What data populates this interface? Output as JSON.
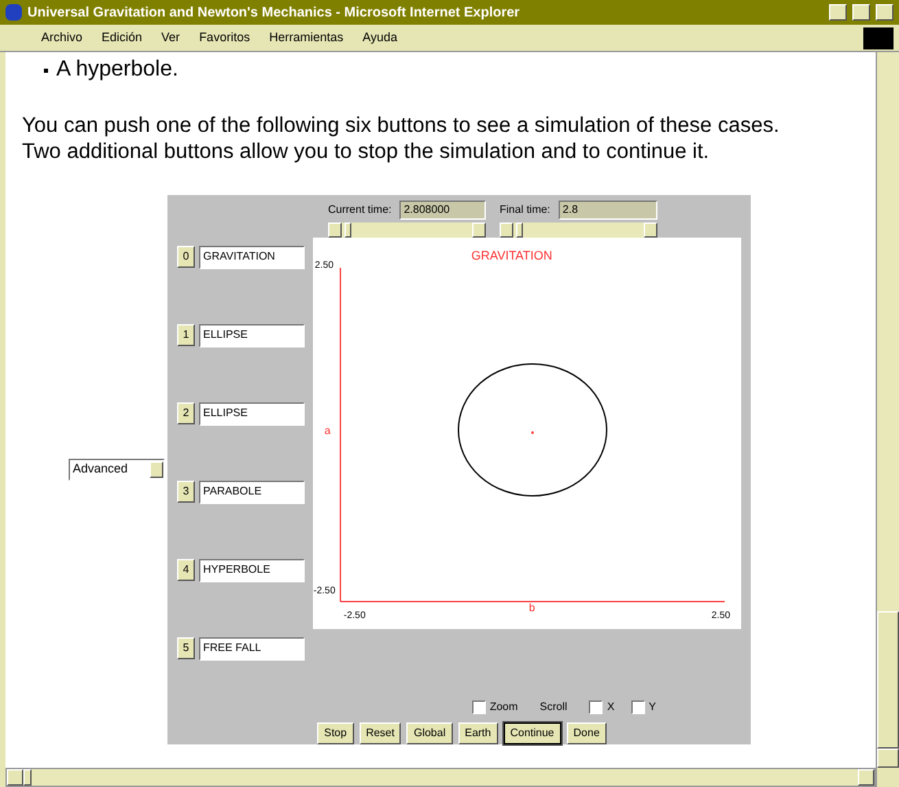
{
  "window": {
    "title": "Universal Gravitation and Newton's Mechanics - Microsoft Internet Explorer"
  },
  "menu": [
    "Archivo",
    "Edición",
    "Ver",
    "Favoritos",
    "Herramientas",
    "Ayuda"
  ],
  "content": {
    "bullet": "A hyperbole.",
    "paragraph": "You can push one of the following six buttons to see a simulation of these cases. Two additional buttons allow you to stop the simulation and to continue it."
  },
  "mode_select": {
    "value": "Advanced"
  },
  "applet": {
    "current_time": {
      "label": "Current time:",
      "value": "2.808000",
      "level": 0.02
    },
    "final_time": {
      "label": "Final time:",
      "value": "2.8",
      "level": 0.02
    },
    "cases": [
      {
        "key": "0",
        "label": "GRAVITATION"
      },
      {
        "key": "1",
        "label": "ELLIPSE"
      },
      {
        "key": "2",
        "label": "ELLIPSE"
      },
      {
        "key": "3",
        "label": "PARABOLE"
      },
      {
        "key": "4",
        "label": "HYPERBOLE"
      },
      {
        "key": "5",
        "label": "FREE FALL"
      }
    ],
    "plot": {
      "title": "GRAVITATION",
      "y_max": "2.50",
      "y_min": "-2.50",
      "y_label": "a",
      "x_min": "-2.50",
      "x_max": "2.50",
      "x_label": "b"
    },
    "options": [
      {
        "label": "Zoom",
        "checked": false
      },
      {
        "label": "Scroll",
        "kind": "text"
      },
      {
        "label": "X",
        "checked": false
      },
      {
        "label": "Y",
        "checked": false
      }
    ],
    "buttons": [
      {
        "label": "Stop",
        "selected": false
      },
      {
        "label": "Reset",
        "selected": false
      },
      {
        "label": "Global",
        "selected": false
      },
      {
        "label": "Earth",
        "selected": false
      },
      {
        "label": "Continue",
        "selected": true
      },
      {
        "label": "Done",
        "selected": false
      }
    ]
  }
}
